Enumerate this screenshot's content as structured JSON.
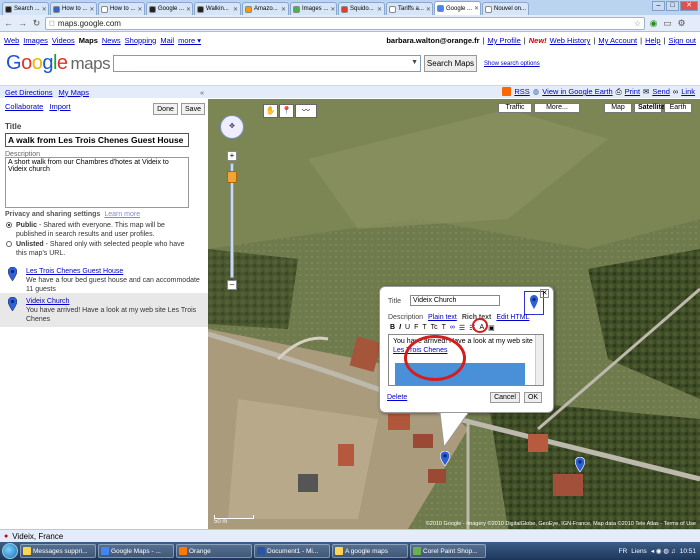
{
  "browser": {
    "tabs": [
      {
        "label": "Search ...",
        "color": "#222222"
      },
      {
        "label": "How to ...",
        "color": "#3366cc"
      },
      {
        "label": "How to ...",
        "color": "#ffffff"
      },
      {
        "label": "Google ...",
        "color": "#222222"
      },
      {
        "label": "Walkin...",
        "color": "#222222"
      },
      {
        "label": "Amazo...",
        "color": "#ff9900"
      },
      {
        "label": "Images ...",
        "color": "#4caf50"
      },
      {
        "label": "Squido...",
        "color": "#e53935"
      },
      {
        "label": "Tariffs a...",
        "color": "#ffffff"
      },
      {
        "label": "Google ...",
        "color": "#4285f4"
      },
      {
        "label": "Nouvel on...",
        "color": "#ffffff"
      }
    ],
    "active_tab_index": 9,
    "url": "maps.google.com"
  },
  "gbar": {
    "links": [
      "Web",
      "Images",
      "Videos",
      "Maps",
      "News",
      "Shopping",
      "Mail",
      "more ▾"
    ],
    "email": "barbara.walton@orange.fr",
    "profile": "My Profile",
    "new": "New!",
    "web_history": "Web History",
    "account": "My Account",
    "help": "Help",
    "signout": "Sign out"
  },
  "search": {
    "logo_google": "Google",
    "logo_maps": "maps",
    "button": "Search Maps",
    "options": "Show search options"
  },
  "mapbar": {
    "get_directions": "Get Directions",
    "my_maps": "My Maps",
    "collapse": "«",
    "rss": "RSS",
    "google_earth": "View in Google Earth",
    "print": "Print",
    "send": "Send",
    "link": "Link"
  },
  "left": {
    "collaborate": "Collaborate",
    "import": "Import",
    "done": "Done",
    "save": "Save",
    "title_label": "Title",
    "title_value": "A walk from Les Trois Chenes Guest House",
    "desc_label": "Description",
    "desc_value": "A short walk from our Chambres d'hotes at Videix to Videix church",
    "privacy_label": "Privacy and sharing settings",
    "learn_more": "Learn more",
    "public_bold": "Public",
    "public_text": " - Shared with everyone. This map will be published in search results and user profiles.",
    "unlisted_bold": "Unlisted",
    "unlisted_text": " - Shared only with selected people who have this map's URL.",
    "places": [
      {
        "title": "Les Trois Chenes Guest House",
        "desc": "We have a four bed guest house and can accommodate 11 guests"
      },
      {
        "title": "Videix Church",
        "desc": "You have arrived! Have a look at my web site Les Trois Chenes"
      }
    ]
  },
  "map": {
    "types": [
      "Traffic",
      "More...",
      "Map",
      "Satellite",
      "Earth"
    ],
    "selected_type": "Satellite",
    "scale": "50 m",
    "copyright": "©2010 Google - Imagery ©2010 DigitalGlobe, GeoEye, IGN-France, Map data ©2010 Tele Atlas - Terms of Use"
  },
  "popup": {
    "title_label": "Title",
    "title_value": "Videix Church",
    "desc_label": "Description",
    "plain": "Plain text",
    "rich": "Rich text",
    "html": "Edit HTML",
    "toolbar": [
      "B",
      "I",
      "U",
      "F",
      "T",
      "Tc",
      "T",
      "∞",
      "☰",
      "☷",
      "A",
      "▣"
    ],
    "body_text": "You have arrived! Have a look at my web site",
    "body_link": "Les Trois Chenes",
    "delete": "Delete",
    "cancel": "Cancel",
    "ok": "OK"
  },
  "status": {
    "text": "Videix, France"
  },
  "taskbar": {
    "items": [
      {
        "label": "Messages suppri...",
        "color": "#ffd54f"
      },
      {
        "label": "Google Maps - ...",
        "color": "#4285f4"
      },
      {
        "label": "Orange",
        "color": "#ff7900"
      },
      {
        "label": "Document1 - Mi...",
        "color": "#2b579a"
      },
      {
        "label": "A google maps",
        "color": "#ffd54f"
      },
      {
        "label": "Corel Paint Shop...",
        "color": "#6ab04c"
      }
    ],
    "tray_lang": "FR",
    "tray_liens": "Liens",
    "clock": "10:51"
  }
}
